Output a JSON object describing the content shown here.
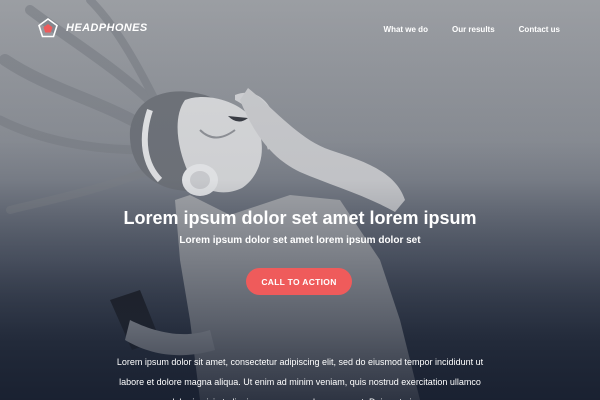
{
  "brand": {
    "name": "HEADPHONES",
    "accent": "#ef5b5b"
  },
  "nav": {
    "items": [
      {
        "label": "What we do"
      },
      {
        "label": "Our results"
      },
      {
        "label": "Contact us"
      }
    ]
  },
  "hero": {
    "headline": "Lorem ipsum dolor set amet lorem ipsum",
    "subheadline": "Lorem ipsum dolor set amet lorem ipsum dolor set",
    "cta_label": "CALL TO ACTION",
    "body": "Lorem ipsum dolor sit amet, consectetur adipiscing elit, sed do eiusmod tempor incididunt ut labore et dolore magna aliqua. Ut enim ad minim veniam, quis nostrud exercitation ullamco laboris nisi ut aliquip ex ea commodo consequat. Duis aute irure"
  }
}
